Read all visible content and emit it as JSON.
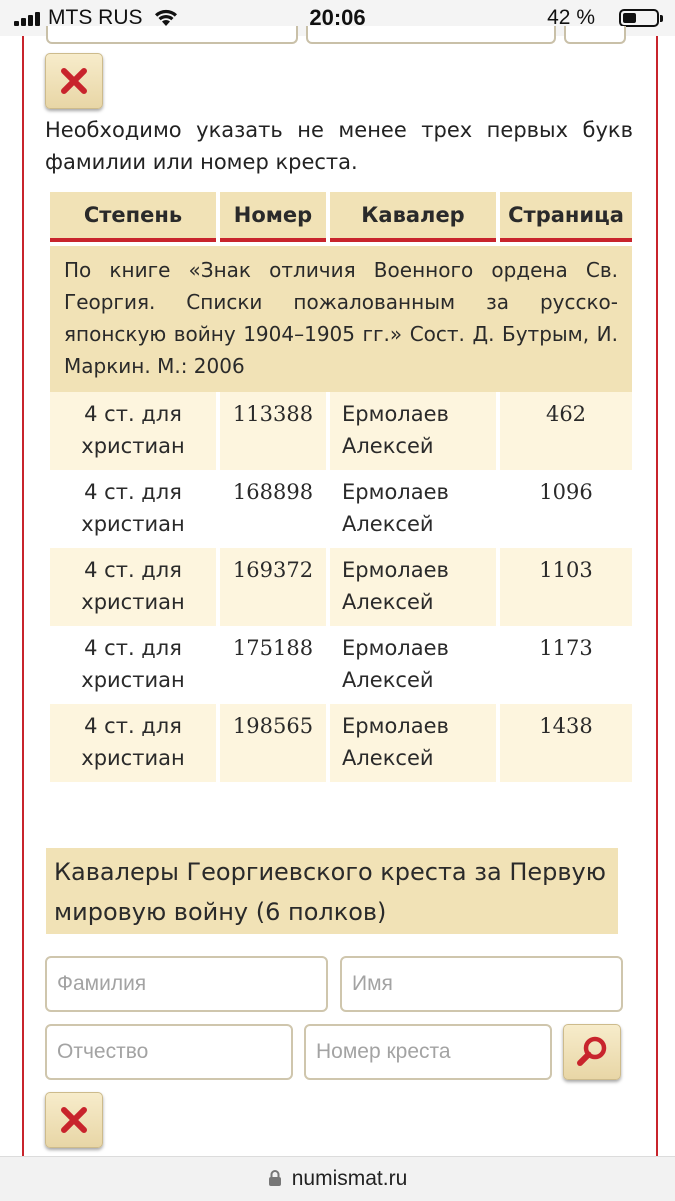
{
  "status_bar": {
    "carrier": "MTS RUS",
    "time": "20:06",
    "battery_percent": "42 %",
    "battery_level": 0.42
  },
  "notice": "Необходимо указать не менее трех первых букв фамилии или номер креста.",
  "table": {
    "headers": [
      "Степень",
      "Номер",
      "Кавалер",
      "Страница"
    ],
    "source": "По книге «Знак отличия Военного ордена Св. Георгия. Списки пожалованным за русско-японскую войну 1904–1905 гг.» Сост. Д. Бутрым, И. Маркин. М.: 2006",
    "rows": [
      {
        "degree": "4 ст. для христиан",
        "number": "113388",
        "name": "Ермолаев Алексей",
        "page": "462"
      },
      {
        "degree": "4 ст. для христиан",
        "number": "168898",
        "name": "Ермолаев Алексей",
        "page": "1096"
      },
      {
        "degree": "4 ст. для христиан",
        "number": "169372",
        "name": "Ермолаев Алексей",
        "page": "1103"
      },
      {
        "degree": "4 ст. для христиан",
        "number": "175188",
        "name": "Ермолаев Алексей",
        "page": "1173"
      },
      {
        "degree": "4 ст. для христиан",
        "number": "198565",
        "name": "Ермолаев Алексей",
        "page": "1438"
      }
    ]
  },
  "section2": {
    "title": "Кавалеры Георгиевского креста за Первую мировую войну (6 полков)",
    "surname_placeholder": "Фамилия",
    "name_placeholder": "Имя",
    "patronymic_placeholder": "Отчество",
    "cross_placeholder": "Номер креста"
  },
  "url_bar": {
    "domain": "numismat.ru"
  },
  "colors": {
    "accent_red": "#c8242c",
    "header_beige": "#f1e2b6",
    "row_cream": "#fdf5de"
  },
  "icons": {
    "clear": "close-icon",
    "search": "search-icon",
    "lock": "lock-icon"
  }
}
